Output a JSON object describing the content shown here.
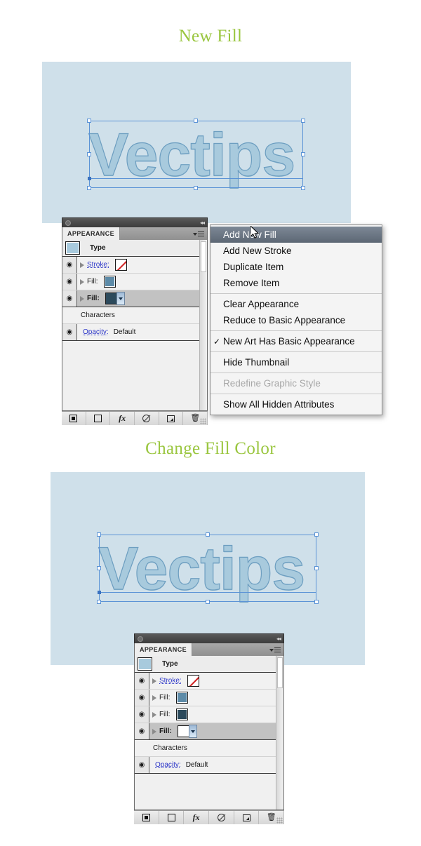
{
  "sections": [
    {
      "title": "New Fill",
      "artwork_text": "Vectips"
    },
    {
      "title": "Change Fill Color",
      "artwork_text": "Vectips"
    }
  ],
  "colors": {
    "heading_green": "#9ac63f",
    "artboard_blue": "#cfe0ea",
    "selection_blue": "#5b93d6",
    "fill_steel": "#5d8ba8",
    "fill_dark_slate": "#2c4a5c",
    "fill_white": "#ffffff",
    "menu_highlight": "#5c6774",
    "panel_bg": "#f0f0f0"
  },
  "panel_top": {
    "titlebar": {
      "collapse_glyph": "◂◂"
    },
    "tab_label": "APPEARANCE",
    "rows": [
      {
        "type": "header",
        "label": "Type",
        "thumbnail_color": "#a8cadd",
        "has_eye": false
      },
      {
        "type": "item",
        "label": "Stroke:",
        "link": true,
        "swatch": "none",
        "has_eye": true
      },
      {
        "type": "item",
        "label": "Fill:",
        "link": false,
        "swatch": "#5d8ba8",
        "has_eye": true
      },
      {
        "type": "item",
        "label": "Fill:",
        "link": false,
        "swatch": "#2c4a5c",
        "has_eye": true,
        "selected": true,
        "has_dropdown": true
      },
      {
        "type": "group",
        "label": "Characters",
        "has_eye": false
      },
      {
        "type": "opacity",
        "label": "Opacity:",
        "value": "Default",
        "has_eye": true
      }
    ],
    "footer_buttons": [
      {
        "name": "add-new-stroke",
        "icon": "filled-square-icon"
      },
      {
        "name": "add-new-fill",
        "icon": "open-square-icon"
      },
      {
        "name": "add-new-effect",
        "icon": "fx-icon",
        "label": "fx"
      },
      {
        "name": "clear-appearance",
        "icon": "no-symbol-icon"
      },
      {
        "name": "duplicate-item",
        "icon": "duplicate-icon"
      },
      {
        "name": "delete-item",
        "icon": "trash-icon",
        "label": "🗑"
      }
    ]
  },
  "panel_bottom": {
    "titlebar": {
      "collapse_glyph": "◂◂"
    },
    "tab_label": "APPEARANCE",
    "rows": [
      {
        "type": "header",
        "label": "Type",
        "thumbnail_color": "#a8cadd",
        "has_eye": false
      },
      {
        "type": "item",
        "label": "Stroke:",
        "link": true,
        "swatch": "none",
        "has_eye": true
      },
      {
        "type": "item",
        "label": "Fill:",
        "link": false,
        "swatch": "#5d8ba8",
        "has_eye": true
      },
      {
        "type": "item",
        "label": "Fill:",
        "link": false,
        "swatch": "#2c4a5c",
        "has_eye": true
      },
      {
        "type": "item",
        "label": "Fill:",
        "link": false,
        "swatch": "#ffffff",
        "has_eye": true,
        "selected": true,
        "has_dropdown": true
      },
      {
        "type": "group",
        "label": "Characters",
        "has_eye": false
      },
      {
        "type": "opacity",
        "label": "Opacity:",
        "value": "Default",
        "has_eye": true
      }
    ],
    "footer_buttons": [
      {
        "name": "add-new-stroke",
        "icon": "filled-square-icon"
      },
      {
        "name": "add-new-fill",
        "icon": "open-square-icon"
      },
      {
        "name": "add-new-effect",
        "icon": "fx-icon",
        "label": "fx"
      },
      {
        "name": "clear-appearance",
        "icon": "no-symbol-icon"
      },
      {
        "name": "duplicate-item",
        "icon": "duplicate-icon"
      },
      {
        "name": "delete-item",
        "icon": "trash-icon",
        "label": "🗑"
      }
    ]
  },
  "context_menu": {
    "items": [
      {
        "label": "Add New Fill",
        "state": "highlighted"
      },
      {
        "label": "Add New Stroke",
        "state": "normal"
      },
      {
        "label": "Duplicate Item",
        "state": "normal"
      },
      {
        "label": "Remove Item",
        "state": "normal"
      },
      {
        "separator": true
      },
      {
        "label": "Clear Appearance",
        "state": "normal"
      },
      {
        "label": "Reduce to Basic Appearance",
        "state": "normal"
      },
      {
        "separator": true
      },
      {
        "label": "New Art Has Basic Appearance",
        "state": "checked",
        "check": "✓"
      },
      {
        "separator": true
      },
      {
        "label": "Hide Thumbnail",
        "state": "normal"
      },
      {
        "separator": true
      },
      {
        "label": "Redefine Graphic Style",
        "state": "disabled"
      },
      {
        "separator": true
      },
      {
        "label": "Show All Hidden Attributes",
        "state": "normal"
      }
    ]
  },
  "eye_glyph": "◉"
}
